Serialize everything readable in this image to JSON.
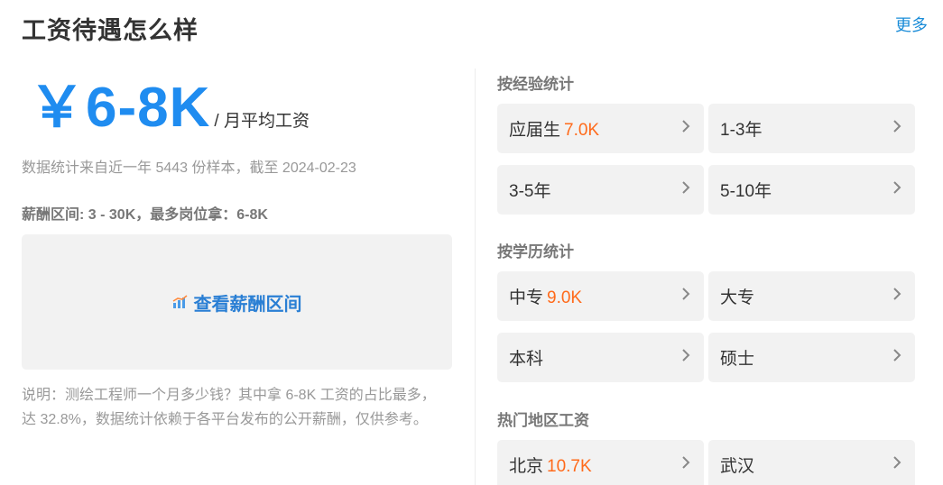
{
  "header": {
    "title": "工资待遇怎么样",
    "more_label": "更多"
  },
  "salary": {
    "value": "￥6-8K",
    "unit": "/ 月平均工资",
    "stats_note": "数据统计来自近一年 5443 份样本，截至 2024-02-23",
    "range_line": "薪酬区间: 3 - 30K，最多岗位拿：6-8K",
    "box_label": "查看薪酬区间",
    "description": "说明：测绘工程师一个月多少钱？其中拿 6-8K 工资的占比最多，达 32.8%，数据统计依赖于各平台发布的公开薪酬，仅供参考。"
  },
  "experience": {
    "title": "按经验统计",
    "items": [
      {
        "label": "应届生",
        "value": "7.0K"
      },
      {
        "label": "1-3年",
        "value": ""
      },
      {
        "label": "3-5年",
        "value": ""
      },
      {
        "label": "5-10年",
        "value": ""
      }
    ]
  },
  "education": {
    "title": "按学历统计",
    "items": [
      {
        "label": "中专",
        "value": "9.0K"
      },
      {
        "label": "大专",
        "value": ""
      },
      {
        "label": "本科",
        "value": ""
      },
      {
        "label": "硕士",
        "value": ""
      }
    ]
  },
  "regions": {
    "title": "热门地区工资",
    "items": [
      {
        "label": "北京",
        "value": "10.7K"
      },
      {
        "label": "武汉",
        "value": ""
      }
    ]
  },
  "colors": {
    "accent_blue": "#1f8cf0",
    "link_blue": "#1a8cd8",
    "highlight_orange": "#ff6a1a",
    "card_bg": "#f2f2f2"
  },
  "icons": {
    "box_icon": "bar-chart-icon",
    "card_icon": "chevron-right-icon"
  }
}
